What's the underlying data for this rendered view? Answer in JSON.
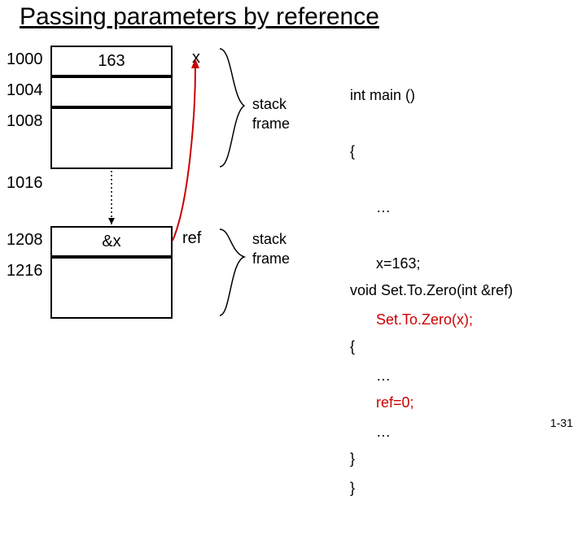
{
  "title": "Passing parameters by reference",
  "mem": {
    "addr_1000": "1000",
    "addr_1004": "1004",
    "addr_1008": "1008",
    "addr_1016": "1016",
    "addr_1208": "1208",
    "addr_1216": "1216",
    "cell_1000": "163",
    "cell_1004": "",
    "cell_1008": "",
    "cell_1208": "&x",
    "cell_1216": ""
  },
  "vars": {
    "x": "x",
    "ref": "ref"
  },
  "labels": {
    "stack1": "stack",
    "frame1": "frame",
    "stack2": "stack",
    "frame2": "frame"
  },
  "code_main": {
    "sig": "int main ()",
    "open": "{",
    "l1": "…",
    "l2": "x=163;",
    "l3": "Set.To.Zero(x);",
    "l4": "…",
    "l5": "…",
    "close": "}"
  },
  "code_set": {
    "sig": "void Set.To.Zero(int &ref)",
    "open": "{",
    "l1": "ref=0;",
    "close": "}"
  },
  "pagenum": "1-31"
}
